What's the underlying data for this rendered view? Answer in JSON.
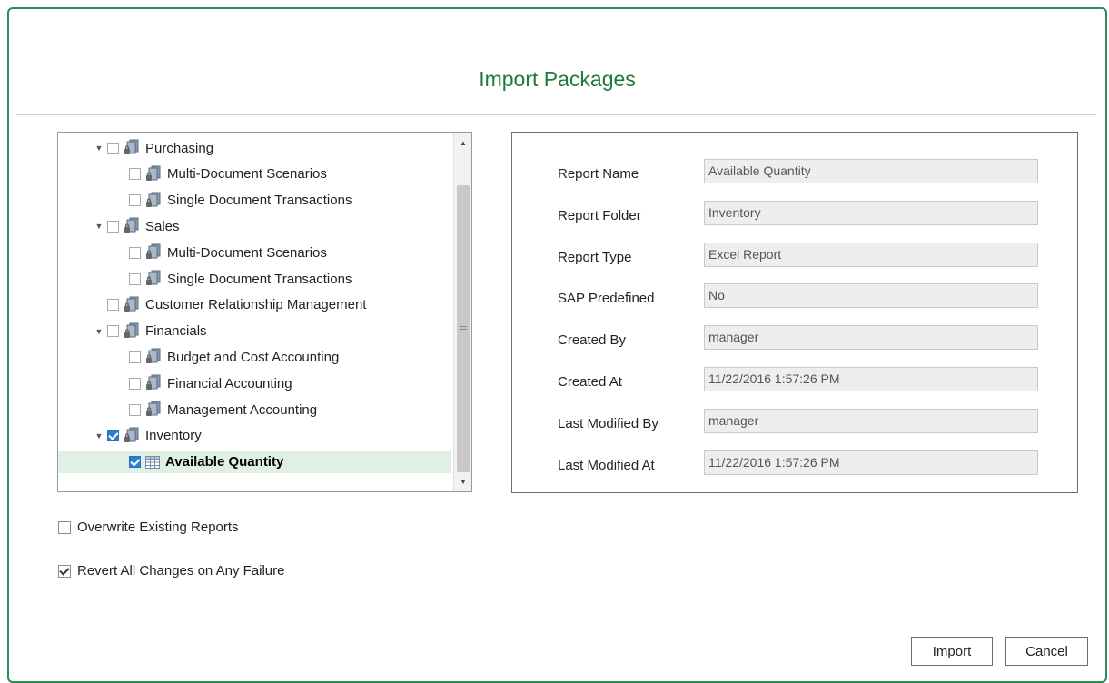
{
  "dialog": {
    "title": "Import Packages"
  },
  "tree": {
    "items": [
      {
        "label": "Purchasing",
        "level": 0,
        "expandable": true,
        "checked": false,
        "icon": "package-icon"
      },
      {
        "label": "Multi-Document Scenarios",
        "level": 1,
        "expandable": false,
        "checked": false,
        "icon": "package-icon"
      },
      {
        "label": "Single Document Transactions",
        "level": 1,
        "expandable": false,
        "checked": false,
        "icon": "package-icon"
      },
      {
        "label": "Sales",
        "level": 0,
        "expandable": true,
        "checked": false,
        "icon": "package-icon"
      },
      {
        "label": "Multi-Document Scenarios",
        "level": 1,
        "expandable": false,
        "checked": false,
        "icon": "package-icon"
      },
      {
        "label": "Single Document Transactions",
        "level": 1,
        "expandable": false,
        "checked": false,
        "icon": "package-icon"
      },
      {
        "label": "Customer Relationship Management",
        "level": 0,
        "expandable": false,
        "checked": false,
        "icon": "package-icon"
      },
      {
        "label": "Financials",
        "level": 0,
        "expandable": true,
        "checked": false,
        "icon": "package-icon"
      },
      {
        "label": "Budget and Cost Accounting",
        "level": 1,
        "expandable": false,
        "checked": false,
        "icon": "package-icon"
      },
      {
        "label": "Financial Accounting",
        "level": 1,
        "expandable": false,
        "checked": false,
        "icon": "package-icon"
      },
      {
        "label": "Management Accounting",
        "level": 1,
        "expandable": false,
        "checked": false,
        "icon": "package-icon"
      },
      {
        "label": "Inventory",
        "level": 0,
        "expandable": true,
        "checked": true,
        "icon": "package-icon"
      },
      {
        "label": "Available Quantity",
        "level": 1,
        "expandable": false,
        "checked": true,
        "icon": "table-icon",
        "selected": true
      }
    ]
  },
  "properties": {
    "rows": [
      {
        "label": "Report Name",
        "value": "Available Quantity"
      },
      {
        "label": "Report Folder",
        "value": "Inventory"
      },
      {
        "label": "Report Type",
        "value": "Excel Report"
      },
      {
        "label": "SAP Predefined",
        "value": "No"
      },
      {
        "label": "Created By",
        "value": "manager"
      },
      {
        "label": "Created At",
        "value": "11/22/2016 1:57:26 PM"
      },
      {
        "label": "Last Modified By",
        "value": "manager"
      },
      {
        "label": "Last Modified At",
        "value": "11/22/2016 1:57:26 PM"
      }
    ]
  },
  "options": {
    "overwrite_label": "Overwrite Existing Reports",
    "overwrite_checked": false,
    "revert_label": "Revert All Changes on Any Failure",
    "revert_checked": true
  },
  "buttons": {
    "import_label": "Import",
    "cancel_label": "Cancel"
  },
  "colors": {
    "accent": "#1f7a3a",
    "border": "#2e8b57",
    "selected_row": "#dff1e4",
    "checkbox_checked": "#2f7fd1"
  }
}
